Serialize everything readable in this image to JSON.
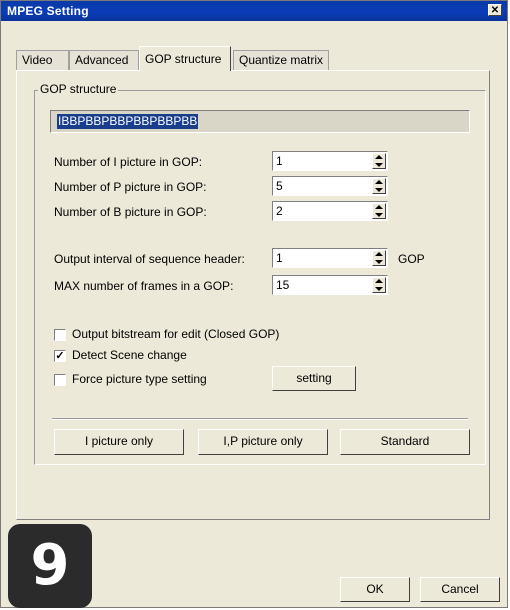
{
  "window": {
    "title": "MPEG Setting",
    "close_label": "✕"
  },
  "tabs": [
    {
      "label": "Video"
    },
    {
      "label": "Advanced"
    },
    {
      "label": "GOP structure"
    },
    {
      "label": "Quantize matrix"
    }
  ],
  "gop": {
    "group_label": "GOP structure",
    "sequence": "IBBPBBPBBPBBPBBPBB",
    "fields": [
      {
        "label": "Number of I picture in GOP:",
        "value": "1"
      },
      {
        "label": "Number of P picture in GOP:",
        "value": "5"
      },
      {
        "label": "Number of B picture in GOP:",
        "value": "2"
      },
      {
        "label": "Output interval of sequence header:",
        "value": "1",
        "unit": "GOP"
      },
      {
        "label": "MAX number of frames in a GOP:",
        "value": "15"
      }
    ],
    "checkboxes": [
      {
        "label": "Output bitstream for edit (Closed GOP)",
        "checked": false
      },
      {
        "label": "Detect Scene change",
        "checked": true
      },
      {
        "label": "Force picture type setting",
        "checked": false
      }
    ],
    "setting_button": "setting",
    "presets": [
      "I picture only",
      "I,P picture only",
      "Standard"
    ]
  },
  "dialog": {
    "ok": "OK",
    "cancel": "Cancel"
  },
  "badge": {
    "number": "9"
  }
}
